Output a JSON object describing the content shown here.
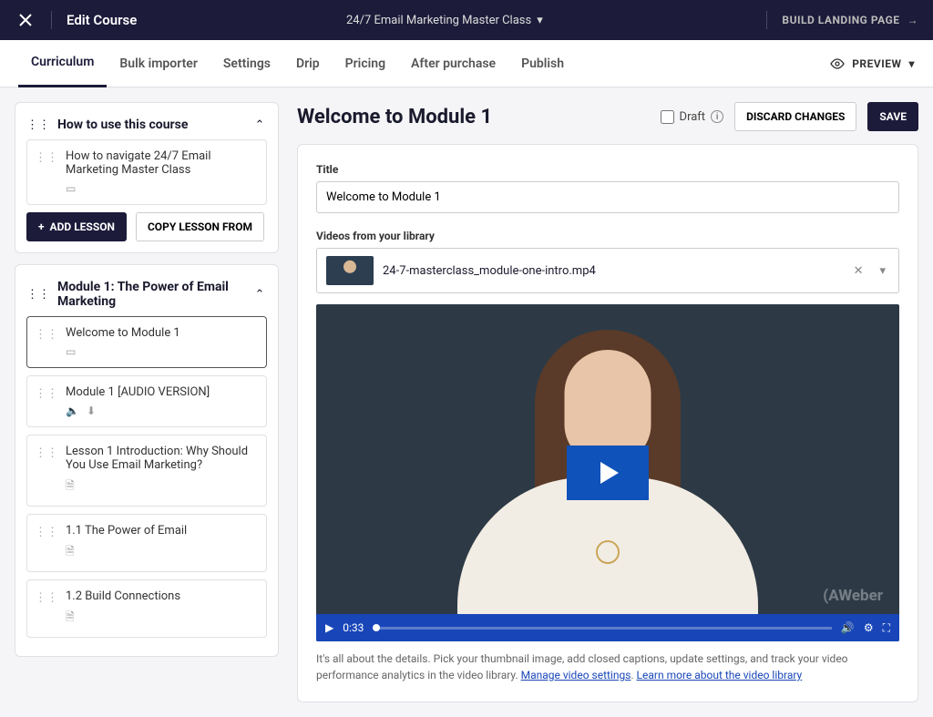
{
  "topbar": {
    "title": "Edit Course",
    "course_name": "24/7 Email Marketing Master Class",
    "build_label": "BUILD LANDING PAGE"
  },
  "tabs": {
    "items": [
      "Curriculum",
      "Bulk importer",
      "Settings",
      "Drip",
      "Pricing",
      "After purchase",
      "Publish"
    ],
    "active": 0,
    "preview_label": "PREVIEW"
  },
  "modules": [
    {
      "title": "How to use this course",
      "lessons": [
        {
          "title": "How to navigate 24/7 Email Marketing Master Class",
          "type": "video"
        }
      ],
      "add_lesson_label": "ADD LESSON",
      "copy_lesson_label": "COPY LESSON FROM"
    },
    {
      "title": "Module 1: The Power of Email Marketing",
      "lessons": [
        {
          "title": "Welcome to Module 1",
          "type": "video",
          "selected": true
        },
        {
          "title": "Module 1 [AUDIO VERSION]",
          "type": "audio"
        },
        {
          "title": "Lesson 1 Introduction: Why Should You Use Email Marketing?",
          "type": "text"
        },
        {
          "title": "1.1 The Power of Email",
          "type": "text"
        },
        {
          "title": "1.2 Build Connections",
          "type": "text"
        }
      ]
    }
  ],
  "editor": {
    "heading": "Welcome to Module 1",
    "draft_label": "Draft",
    "discard_label": "DISCARD CHANGES",
    "save_label": "SAVE",
    "title_label": "Title",
    "title_value": "Welcome to Module 1",
    "video_section_label": "Videos from your library",
    "video_filename": "24-7-masterclass_module-one-intro.mp4",
    "watermark": "(AWeber",
    "timestamp": "0:33",
    "help_text_1": "It's all about the details. Pick your thumbnail image, add closed captions, update settings, and track your video performance analytics in the video library. ",
    "help_link_1": "Manage video settings",
    "help_sep": ". ",
    "help_link_2": "Learn more about the video library"
  }
}
